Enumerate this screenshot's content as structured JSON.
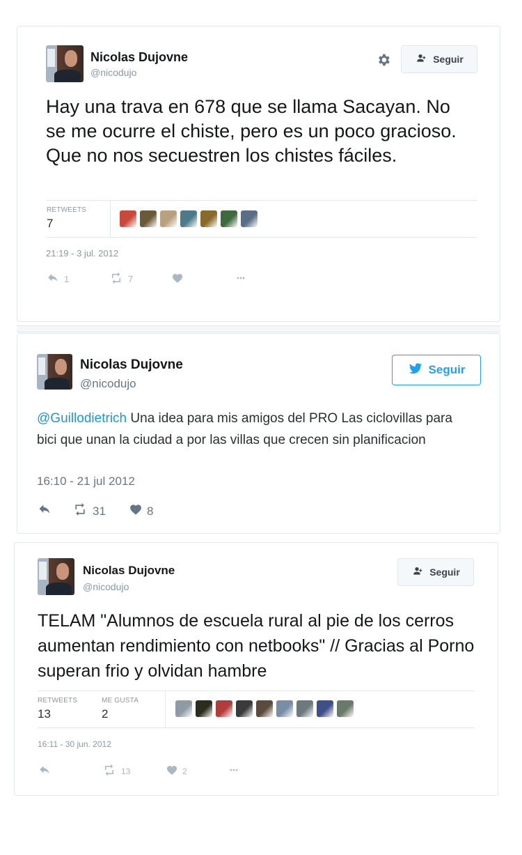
{
  "tweet1": {
    "name": "Nicolas Dujovne",
    "handle": "@nicodujo",
    "follow_label": "Seguir",
    "text": "Hay una trava en 678 que se llama Sacayan. No se me ocurre el chiste, pero es un poco gracioso. Que no nos secuestren los chistes fáciles.",
    "retweets_label": "RETWEETS",
    "retweets_value": "7",
    "date": "21:19 - 3 jul. 2012",
    "reply_count": "1",
    "retweet_count": "7"
  },
  "tweet2": {
    "name": "Nicolas Dujovne",
    "handle": "@nicodujo",
    "follow_label": "Seguir",
    "mention": "@Guillodietrich",
    "text": " Una idea para mis amigos del PRO Las ciclovillas para bici que unan la ciudad a por las villas que crecen sin planificacion",
    "date": "16:10 - 21 jul 2012",
    "retweet_count": "31",
    "like_count": "8"
  },
  "tweet3": {
    "name": "Nicolas Dujovne",
    "handle": "@nicodujo",
    "follow_label": "Seguir",
    "text": "TELAM \"Alumnos de escuela rural al pie de los cerros aumentan rendimiento con netbooks\" // Gracias al Porno superan frio y olvidan hambre",
    "retweets_label": "RETWEETS",
    "retweets_value": "13",
    "likes_label": "ME GUSTA",
    "likes_value": "2",
    "date": "16:11 - 30 jun. 2012",
    "retweet_count": "13",
    "like_count": "2"
  },
  "icons": [
    "gear-icon",
    "follow-person-icon",
    "twitter-bird-icon",
    "reply-icon",
    "retweet-icon",
    "heart-icon",
    "more-icon"
  ],
  "colors": {
    "link": "#1b95e0",
    "twitter_blue": "#1da1f2",
    "muted": "#8899a6",
    "border": "#e1e8ed"
  },
  "tweet1_rt_avatar_colors": [
    "#c94a3a",
    "#6b5a3a",
    "#b9a07e",
    "#4d7a8a",
    "#8a6a2a",
    "#3f6a3f",
    "#5a6e86"
  ],
  "tweet3_rt_avatar_colors": [
    "#8f9aa6",
    "#2b2b1e",
    "#b23c3c",
    "#3a3a3a",
    "#5d4a3e",
    "#7a8da6",
    "#6d7a7d",
    "#3e4f8a",
    "#6a7a6a"
  ]
}
